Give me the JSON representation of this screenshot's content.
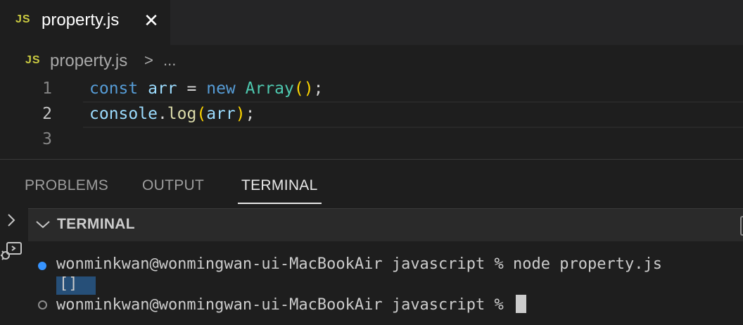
{
  "tab": {
    "badge": "JS",
    "label": "property.js",
    "close": "✕"
  },
  "breadcrumb": {
    "badge": "JS",
    "file": "property.js",
    "separator": ">",
    "more": "..."
  },
  "editor": {
    "lines": [
      {
        "number": "1",
        "tokens": [
          "const",
          "arr",
          "=",
          "new",
          "Array",
          "(",
          ")",
          ";"
        ]
      },
      {
        "number": "2",
        "tokens": [
          "console",
          ".",
          "log",
          "(",
          "arr",
          ")",
          ";"
        ]
      },
      {
        "number": "3",
        "tokens": []
      }
    ],
    "active_line": "2"
  },
  "panel": {
    "tabs": [
      "PROBLEMS",
      "OUTPUT",
      "TERMINAL"
    ],
    "active_tab": "TERMINAL"
  },
  "terminal": {
    "title": "TERMINAL",
    "lines": [
      "wonminkwan@wonmingwan-ui-MacBookAir javascript % node property.js",
      "[]",
      "wonminkwan@wonmingwan-ui-MacBookAir javascript % "
    ]
  },
  "colors": {
    "js_badge": "#cbcb41",
    "keyword": "#569cd6",
    "variable": "#9cdcfe",
    "class": "#4ec9b0",
    "function": "#dcdcaa",
    "bracket": "#ffd700",
    "bracket_nested": "#da70d6",
    "success_dot": "#3794ff",
    "selection": "#264f78"
  },
  "icons": [
    "close-icon",
    "chevron-right-icon",
    "chevron-down-icon",
    "debug-console-icon"
  ]
}
